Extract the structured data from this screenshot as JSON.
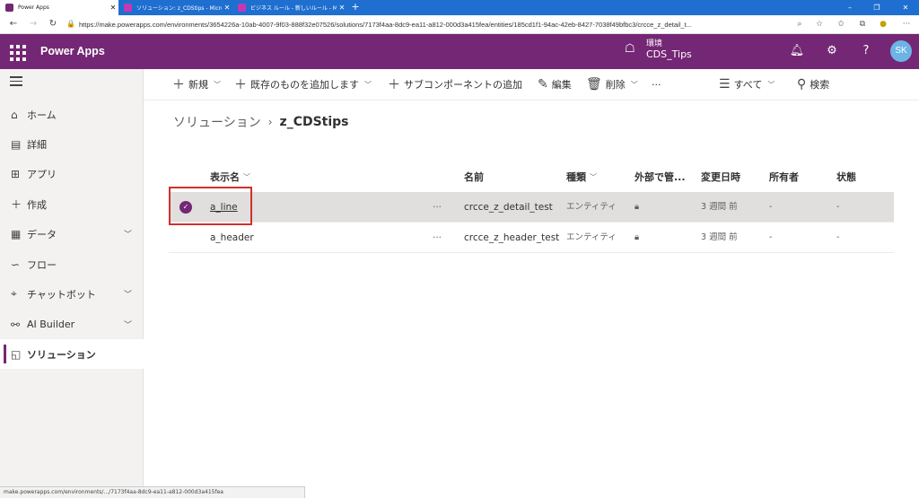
{
  "browser": {
    "tabs": [
      {
        "title": "Power Apps",
        "active": true
      },
      {
        "title": "ソリューション: z_CDStips - Microso",
        "active": false
      },
      {
        "title": "ビジネス ルール - 新しいルール - Micr",
        "active": false
      }
    ],
    "url": "https://make.powerapps.com/environments/3654226a-10ab-4007-9f03-888f32e07526/solutions/7173f4aa-8dc9-ea11-a812-000d3a415fea/entities/185cd1f1-94ac-42eb-8427-7038f49bfbc3/crcce_z_detail_t..."
  },
  "app": {
    "name": "Power Apps",
    "env_label": "環境",
    "env_name": "CDS_Tips",
    "avatar": "SK",
    "accent": "#742774"
  },
  "leftnav": {
    "items": [
      {
        "label": "ホーム",
        "icon": "home-icon",
        "chevron": false
      },
      {
        "label": "詳細",
        "icon": "book-icon",
        "chevron": false
      },
      {
        "label": "アプリ",
        "icon": "apps-icon",
        "chevron": false
      },
      {
        "label": "作成",
        "icon": "plus-icon",
        "chevron": false
      },
      {
        "label": "データ",
        "icon": "table-icon",
        "chevron": true
      },
      {
        "label": "フロー",
        "icon": "flow-icon",
        "chevron": false
      },
      {
        "label": "チャットボット",
        "icon": "bot-icon",
        "chevron": true
      },
      {
        "label": "AI Builder",
        "icon": "ai-icon",
        "chevron": true
      },
      {
        "label": "ソリューション",
        "icon": "solution-icon",
        "chevron": false,
        "selected": true
      }
    ]
  },
  "commandbar": {
    "new": "新規",
    "add_existing": "既存のものを追加します",
    "add_subcomponent": "サブコンポーネントの追加",
    "edit": "編集",
    "delete": "削除",
    "more": "···",
    "filter": "すべて",
    "search": "検索"
  },
  "breadcrumb": {
    "root": "ソリューション",
    "current": "z_CDStips"
  },
  "table": {
    "headers": {
      "display_name": "表示名",
      "name": "名前",
      "type": "種類",
      "managed": "外部で管...",
      "modified": "変更日時",
      "owner": "所有者",
      "status": "状態"
    },
    "rows": [
      {
        "display_name": "a_line",
        "more": "···",
        "name": "crcce_z_detail_test",
        "type": "エンティティ",
        "modified": "3 週間 前",
        "owner": "-",
        "status": "-",
        "selected": true
      },
      {
        "display_name": "a_header",
        "more": "···",
        "name": "crcce_z_header_test",
        "type": "エンティティ",
        "modified": "3 週間 前",
        "owner": "-",
        "status": "-",
        "selected": false
      }
    ]
  },
  "statusbar": {
    "text": "make.powerapps.com/environments/.../7173f4aa-8dc9-ea11-a812-000d3a415fea"
  }
}
